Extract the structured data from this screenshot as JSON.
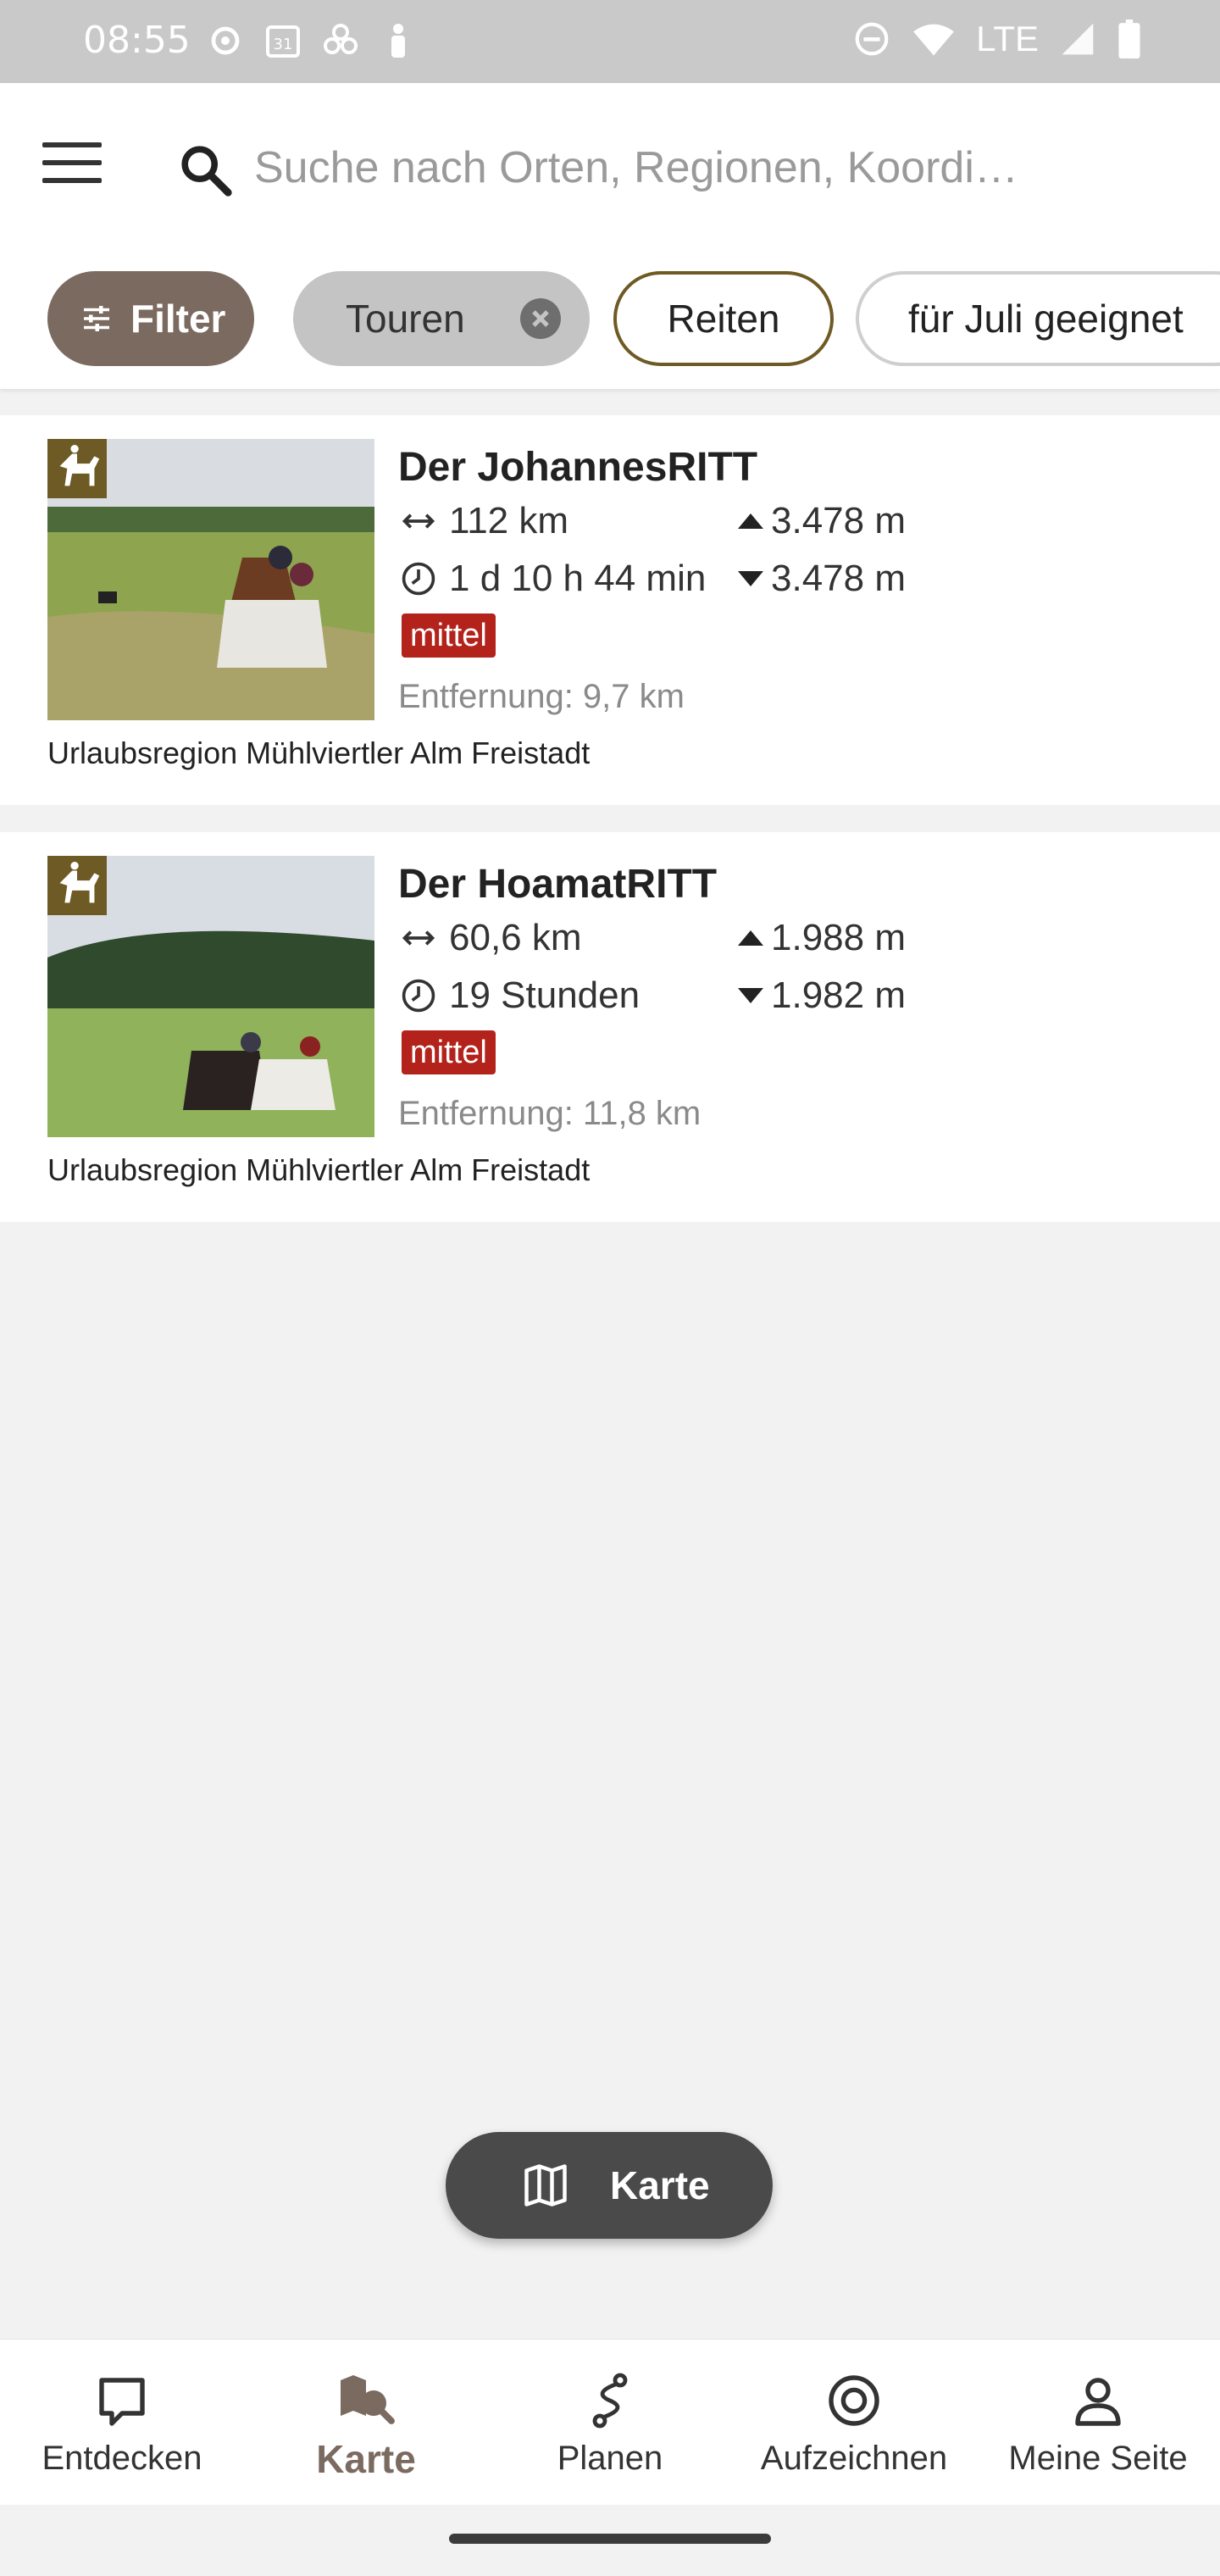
{
  "status_bar": {
    "time": "08:55",
    "network": "LTE"
  },
  "search": {
    "placeholder": "Suche nach Orten, Regionen, Koordi…"
  },
  "chips": {
    "filter": "Filter",
    "touren": "Touren",
    "reiten": "Reiten",
    "juli": "für Juli geeignet"
  },
  "results": [
    {
      "title": "Der JohannesRITT",
      "length": "112 km",
      "duration": "1 d 10 h 44 min",
      "ascent": "3.478 m",
      "descent": "3.478 m",
      "difficulty": "mittel",
      "distance": "Entfernung: 9,7 km",
      "region": "Urlaubsregion Mühlviertler Alm Freistadt"
    },
    {
      "title": "Der HoamatRITT",
      "length": "60,6 km",
      "duration": "19 Stunden",
      "ascent": "1.988 m",
      "descent": "1.982 m",
      "difficulty": "mittel",
      "distance": "Entfernung: 11,8 km",
      "region": "Urlaubsregion Mühlviertler Alm Freistadt"
    }
  ],
  "map_button": {
    "label": "Karte"
  },
  "nav": [
    {
      "label": "Entdecken",
      "icon": "discover-icon"
    },
    {
      "label": "Karte",
      "icon": "map-search-icon"
    },
    {
      "label": "Planen",
      "icon": "route-plan-icon"
    },
    {
      "label": "Aufzeichnen",
      "icon": "record-icon"
    },
    {
      "label": "Meine Seite",
      "icon": "profile-icon"
    }
  ],
  "colors": {
    "accent": "#7b6a5f",
    "badge": "#6e5a24",
    "difficulty": "#b3221b",
    "reiten_border": "#6e5a24"
  }
}
